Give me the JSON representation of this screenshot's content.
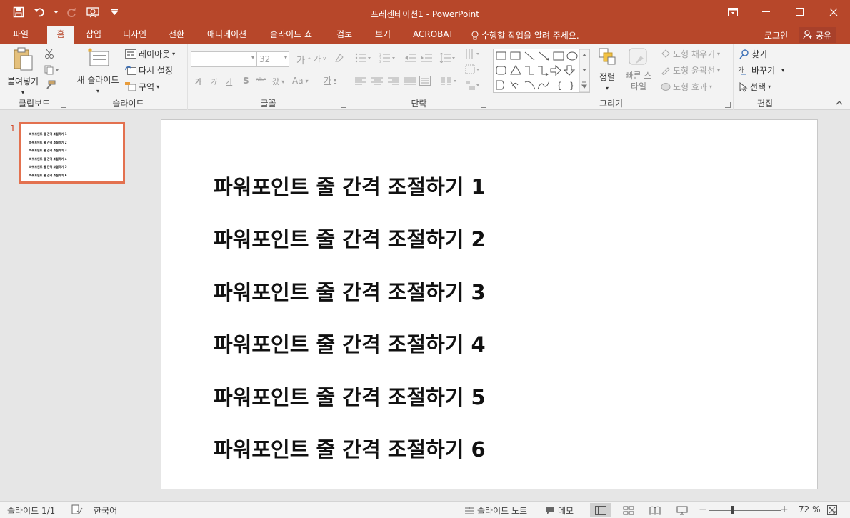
{
  "window": {
    "title": "프레젠테이션1 - PowerPoint"
  },
  "tabs": [
    {
      "label": "파일"
    },
    {
      "label": "홈"
    },
    {
      "label": "삽입"
    },
    {
      "label": "디자인"
    },
    {
      "label": "전환"
    },
    {
      "label": "애니메이션"
    },
    {
      "label": "슬라이드 쇼"
    },
    {
      "label": "검토"
    },
    {
      "label": "보기"
    },
    {
      "label": "ACROBAT"
    }
  ],
  "tell_me": "수행할 작업을 알려 주세요.",
  "account": {
    "login": "로그인",
    "share": "공유"
  },
  "ribbon": {
    "clipboard": {
      "paste": "붙여넣기",
      "label": "클립보드"
    },
    "slides": {
      "new_slide": "새 슬라이드",
      "layout": "레이아웃",
      "reset": "다시 설정",
      "section": "구역",
      "label": "슬라이드"
    },
    "font": {
      "font_name": "",
      "font_size": "32",
      "label": "글꼴",
      "change_case": "Aa"
    },
    "paragraph": {
      "label": "단락"
    },
    "drawing": {
      "arrange": "정렬",
      "quick_styles": "빠른 스타일",
      "shape_fill": "도형 채우기",
      "shape_outline": "도형 윤곽선",
      "shape_effects": "도형 효과",
      "label": "그리기"
    },
    "editing": {
      "find": "찾기",
      "replace": "바꾸기",
      "select": "선택",
      "label": "편집"
    }
  },
  "thumbnails": [
    {
      "number": "1",
      "lines": [
        "파워포인트 줄 간격 조절하기 1",
        "파워포인트 줄 간격 조절하기 2",
        "파워포인트 줄 간격 조절하기 3",
        "파워포인트 줄 간격 조절하기 4",
        "파워포인트 줄 간격 조절하기 5",
        "파워포인트 줄 간격 조절하기 6"
      ]
    }
  ],
  "slide": {
    "lines": [
      "파워포인트 줄 간격 조절하기 1",
      "파워포인트 줄 간격 조절하기 2",
      "파워포인트 줄 간격 조절하기 3",
      "파워포인트 줄 간격 조절하기 4",
      "파워포인트 줄 간격 조절하기 5",
      "파워포인트 줄 간격 조절하기 6"
    ]
  },
  "status": {
    "slide_count": "슬라이드 1/1",
    "language": "한국어",
    "notes": "슬라이드 노트",
    "comments": "메모",
    "zoom": "72 %"
  },
  "colors": {
    "accent": "#b7472a",
    "thumb_border": "#e3714f"
  }
}
